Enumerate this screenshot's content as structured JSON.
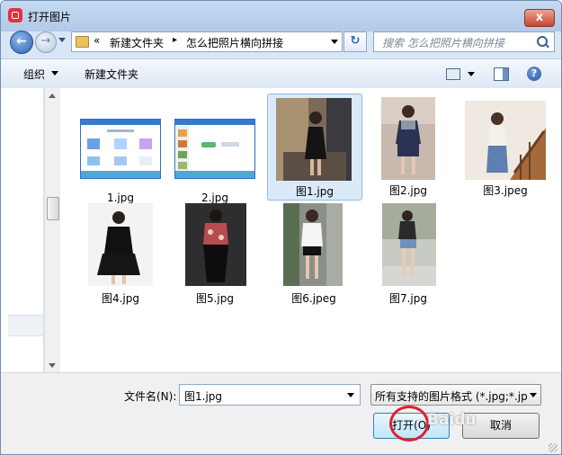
{
  "window": {
    "title": "打开图片",
    "close_label": "x"
  },
  "nav": {
    "back_glyph": "←",
    "forward_glyph": "→",
    "refresh_glyph": "↻"
  },
  "address": {
    "chevrons": "«",
    "part1": "新建文件夹",
    "separator": "▸",
    "part2": "怎么把照片横向拼接"
  },
  "search": {
    "placeholder": "搜索 怎么把照片横向拼接"
  },
  "toolbar": {
    "organize_label": "组织",
    "new_folder_label": "新建文件夹",
    "help_glyph": "?"
  },
  "files": [
    {
      "name": "1.jpg",
      "kind": "screenshot"
    },
    {
      "name": "2.jpg",
      "kind": "screenshot"
    },
    {
      "name": "图1.jpg",
      "kind": "photo",
      "selected": true
    },
    {
      "name": "图2.jpg",
      "kind": "photo"
    },
    {
      "name": "图3.jpeg",
      "kind": "photo"
    },
    {
      "name": "图4.jpg",
      "kind": "photo"
    },
    {
      "name": "图5.jpg",
      "kind": "photo"
    },
    {
      "name": "图6.jpeg",
      "kind": "photo"
    },
    {
      "name": "图7.jpg",
      "kind": "photo"
    }
  ],
  "bottom": {
    "filename_label": "文件名(N):",
    "filename_value": "图1.jpg",
    "filter_value": "所有支持的图片格式 (*.jpg;*.jp",
    "open_label": "打开(O)",
    "cancel_label": "取消"
  },
  "watermark": "Baidu",
  "colors": {
    "accent": "#3c7fb1",
    "selection": "#dbeaf9",
    "annotation": "#e0202a"
  }
}
